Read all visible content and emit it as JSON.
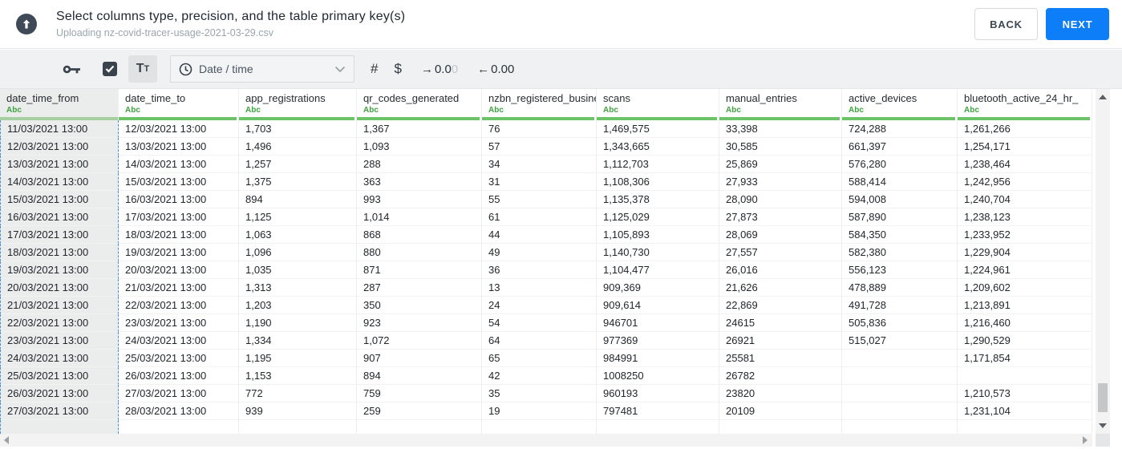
{
  "header": {
    "title": "Select columns type, precision, and the table primary key(s)",
    "subtitle": "Uploading nz-covid-tracer-usage-2021-03-29.csv",
    "back_label": "BACK",
    "next_label": "NEXT"
  },
  "toolbar": {
    "key_icon": "primary-key-icon",
    "checkbox_checked": true,
    "text_type": {
      "large": "T",
      "small": "T"
    },
    "type_dropdown": {
      "icon": "clock-icon",
      "value": "Date / time"
    },
    "hash_label": "#",
    "dollar_label": "$",
    "precision_right": {
      "arrow": "→",
      "dark": "0.0",
      "light": "0"
    },
    "precision_left": {
      "arrow": "←",
      "value": "0.00"
    }
  },
  "table": {
    "type_badge": "Abc",
    "selected_column_index": 0,
    "columns": [
      "date_time_from",
      "date_time_to",
      "app_registrations",
      "qr_codes_generated",
      "nzbn_registered_busine",
      "scans",
      "manual_entries",
      "active_devices",
      "bluetooth_active_24_hr_"
    ],
    "rows": [
      [
        "11/03/2021 13:00",
        "12/03/2021 13:00",
        "1,703",
        "1,367",
        "76",
        "1,469,575",
        "33,398",
        "724,288",
        "1,261,266"
      ],
      [
        "12/03/2021 13:00",
        "13/03/2021 13:00",
        "1,496",
        "1,093",
        "57",
        "1,343,665",
        "30,585",
        "661,397",
        "1,254,171"
      ],
      [
        "13/03/2021 13:00",
        "14/03/2021 13:00",
        "1,257",
        "288",
        "34",
        "1,112,703",
        "25,869",
        "576,280",
        "1,238,464"
      ],
      [
        "14/03/2021 13:00",
        "15/03/2021 13:00",
        "1,375",
        "363",
        "31",
        "1,108,306",
        "27,933",
        "588,414",
        "1,242,956"
      ],
      [
        "15/03/2021 13:00",
        "16/03/2021 13:00",
        "894",
        "993",
        "55",
        "1,135,378",
        "28,090",
        "594,008",
        "1,240,704"
      ],
      [
        "16/03/2021 13:00",
        "17/03/2021 13:00",
        "1,125",
        "1,014",
        "61",
        "1,125,029",
        "27,873",
        "587,890",
        "1,238,123"
      ],
      [
        "17/03/2021 13:00",
        "18/03/2021 13:00",
        "1,063",
        "868",
        "44",
        "1,105,893",
        "28,069",
        "584,350",
        "1,233,952"
      ],
      [
        "18/03/2021 13:00",
        "19/03/2021 13:00",
        "1,096",
        "880",
        "49",
        "1,140,730",
        "27,557",
        "582,380",
        "1,229,904"
      ],
      [
        "19/03/2021 13:00",
        "20/03/2021 13:00",
        "1,035",
        "871",
        "36",
        "1,104,477",
        "26,016",
        "556,123",
        "1,224,961"
      ],
      [
        "20/03/2021 13:00",
        "21/03/2021 13:00",
        "1,313",
        "287",
        "13",
        "909,369",
        "21,626",
        "478,889",
        "1,209,602"
      ],
      [
        "21/03/2021 13:00",
        "22/03/2021 13:00",
        "1,203",
        "350",
        "24",
        "909,614",
        "22,869",
        "491,728",
        "1,213,891"
      ],
      [
        "22/03/2021 13:00",
        "23/03/2021 13:00",
        "1,190",
        "923",
        "54",
        "946701",
        "24615",
        "505,836",
        "1,216,460"
      ],
      [
        "23/03/2021 13:00",
        "24/03/2021 13:00",
        "1,334",
        "1,072",
        "64",
        "977369",
        "26921",
        "515,027",
        "1,290,529"
      ],
      [
        "24/03/2021 13:00",
        "25/03/2021 13:00",
        "1,195",
        "907",
        "65",
        "984991",
        "25581",
        "",
        "1,171,854"
      ],
      [
        "25/03/2021 13:00",
        "26/03/2021 13:00",
        "1,153",
        "894",
        "42",
        "1008250",
        "26782",
        "",
        ""
      ],
      [
        "26/03/2021 13:00",
        "27/03/2021 13:00",
        "772",
        "759",
        "35",
        "960193",
        "23820",
        "",
        "1,210,573"
      ],
      [
        "27/03/2021 13:00",
        "28/03/2021 13:00",
        "939",
        "259",
        "19",
        "797481",
        "20109",
        "",
        "1,231,104"
      ]
    ]
  },
  "colors": {
    "accent_blue": "#0d7ef7",
    "type_green": "#3fa23f",
    "header_underline_green": "#6cc368",
    "selected_column_dash": "#4a8fd9",
    "toolbar_bg": "#eff1f2"
  }
}
